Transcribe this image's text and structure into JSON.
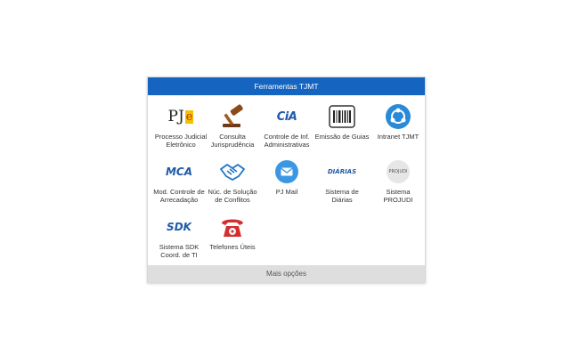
{
  "panel": {
    "title": "Ferramentas TJMT",
    "more_options": "Mais opções"
  },
  "colors": {
    "header": "#1565c0",
    "footer": "#dedede",
    "mca_blue": "#1e5aa8",
    "intranet_blue": "#2a8ad8",
    "pjmail_blue": "#3b97e3",
    "phone_red": "#d32f2f"
  },
  "tiles": [
    {
      "icon": "pje-logo",
      "label_1": "Processo Judicial",
      "label_2": "Eletrônico",
      "logo_text": "PJ",
      "logo_sub": "e"
    },
    {
      "icon": "gavel-icon",
      "label_1": "Consulta",
      "label_2": "Jurisprudência"
    },
    {
      "icon": "cia-logo",
      "label_1": "Controle de Inf.",
      "label_2": "Administrativas",
      "logo_text": "CiA"
    },
    {
      "icon": "barcode-icon",
      "label_1": "Emissão de Guias",
      "label_2": ""
    },
    {
      "icon": "intranet-share-icon",
      "label_1": "Intranet TJMT",
      "label_2": ""
    },
    {
      "icon": "mca-logo",
      "label_1": "Mod. Controle de",
      "label_2": "Arrecadação",
      "logo_text": "MCA"
    },
    {
      "icon": "handshake-icon",
      "label_1": "Núc. de Solução",
      "label_2": "de Conflitos"
    },
    {
      "icon": "mail-icon",
      "label_1": "PJ Mail",
      "label_2": ""
    },
    {
      "icon": "diarias-logo",
      "label_1": "Sistema de Diárias",
      "label_2": "",
      "logo_text": "DIÁRIAS"
    },
    {
      "icon": "projudi-logo",
      "label_1": "Sistema PROJUDI",
      "label_2": "",
      "logo_text": "PROJUDI"
    },
    {
      "icon": "sdk-logo",
      "label_1": "Sistema SDK",
      "label_2": "Coord. de TI",
      "logo_text": "SDK"
    },
    {
      "icon": "telephone-icon",
      "label_1": "Telefones Úteis",
      "label_2": ""
    }
  ]
}
